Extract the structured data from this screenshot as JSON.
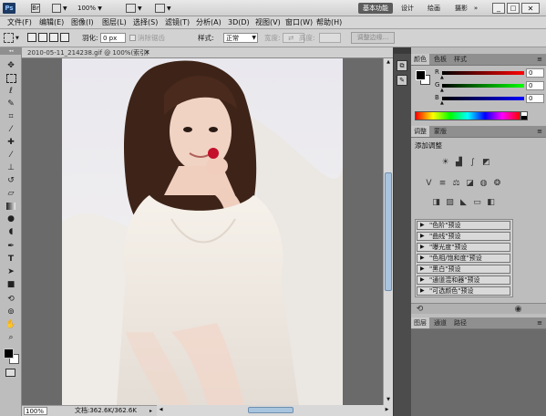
{
  "app": {
    "logo": "Ps",
    "zoom_value": "100%",
    "workspaces": [
      "基本功能",
      "设计",
      "绘画",
      "摄影"
    ],
    "window_controls": [
      "minimize",
      "restore",
      "close"
    ]
  },
  "menu": [
    "文件(F)",
    "编辑(E)",
    "图像(I)",
    "图层(L)",
    "选择(S)",
    "滤镜(T)",
    "分析(A)",
    "3D(D)",
    "视图(V)",
    "窗口(W)",
    "帮助(H)"
  ],
  "options": {
    "feather_label": "羽化:",
    "feather_value": "0 px",
    "antialias_label": "消除锯齿",
    "style_label": "样式:",
    "style_value": "正常",
    "width_label": "宽度:",
    "height_label": "高度:",
    "refine_label": "调整边缘..."
  },
  "document": {
    "tab_title": "2010-05-11_214238.gif @ 100%(索引)",
    "zoom": "100%",
    "status": "文档:362.6K/362.6K"
  },
  "color_panel": {
    "tabs": [
      "颜色",
      "色板",
      "样式"
    ],
    "channels": [
      {
        "label": "R",
        "value": "0",
        "color": "#d42020"
      },
      {
        "label": "G",
        "value": "0",
        "color": "#1fae1f"
      },
      {
        "label": "B",
        "value": "0",
        "color": "#2a3ad8"
      }
    ]
  },
  "adjust_panel": {
    "tabs": [
      "调整",
      "蒙版"
    ],
    "title": "添加调整",
    "presets": [
      "\"色阶\"预设",
      "\"曲线\"预设",
      "\"曝光度\"预设",
      "\"色相/饱和度\"预设",
      "\"黑白\"预设",
      "\"通道混和器\"预设",
      "\"可选颜色\"预设"
    ]
  },
  "layers_panel": {
    "tabs": [
      "图层",
      "通道",
      "路径"
    ]
  },
  "colors": {
    "foreground": "#000000",
    "background": "#ffffff",
    "accent_dark": "#5c5c5c"
  }
}
